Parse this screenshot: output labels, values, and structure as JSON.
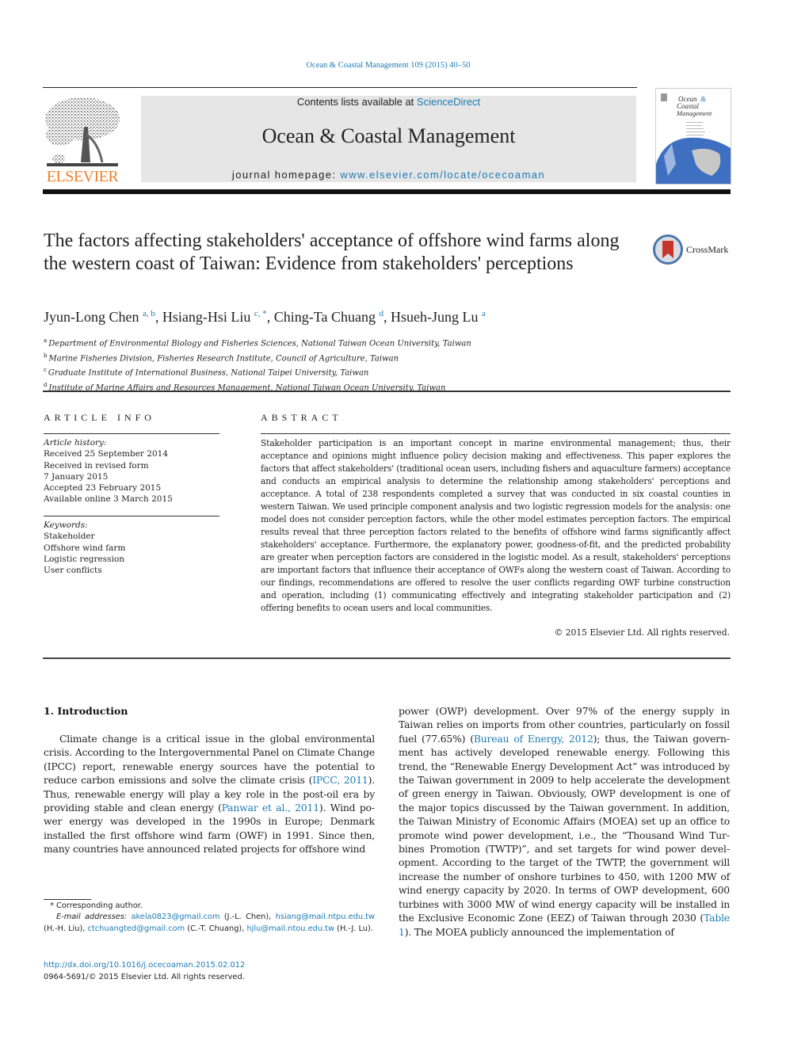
{
  "journal_reference": "Ocean & Coastal Management 109 (2015) 40–50",
  "header": {
    "publisher_logo_text": "ELSEVIER",
    "contents_prefix": "Contents lists available at ",
    "contents_link": "ScienceDirect",
    "journal_title": "Ocean & Coastal Management",
    "homepage_prefix": "journal homepage: ",
    "homepage_link": "www.elsevier.com/locate/ocecoaman",
    "cover_title_lines": [
      "Ocean &",
      "Coastal",
      "Management"
    ],
    "colors": {
      "link": "#1c7bb5",
      "elsevier_orange": "#f07e26",
      "banner_bg": "#e6e6e6"
    }
  },
  "article": {
    "title": "The factors affecting stakeholders' acceptance of offshore wind farms along the western coast of Taiwan: Evidence from stakeholders' perceptions",
    "crossmark_label": "CrossMark",
    "authors": [
      {
        "name": "Jyun-Long Chen",
        "sup": "a, b",
        "sep": ", "
      },
      {
        "name": "Hsiang-Hsi Liu",
        "sup": "c, *",
        "sep": ", "
      },
      {
        "name": "Ching-Ta Chuang",
        "sup": "d",
        "sep": ", "
      },
      {
        "name": "Hsueh-Jung Lu",
        "sup": "a",
        "sep": ""
      }
    ],
    "affiliations": [
      {
        "key": "a",
        "text": "Department of Environmental Biology and Fisheries Sciences, National Taiwan Ocean University, Taiwan"
      },
      {
        "key": "b",
        "text": "Marine Fisheries Division, Fisheries Research Institute, Council of Agriculture, Taiwan"
      },
      {
        "key": "c",
        "text": "Graduate Institute of International Business, National Taipei University, Taiwan"
      },
      {
        "key": "d",
        "text": "Institute of Marine Affairs and Resources Management, National Taiwan Ocean University, Taiwan"
      }
    ]
  },
  "article_info": {
    "heading": "ARTICLE INFO",
    "history_label": "Article history:",
    "history": [
      "Received 25 September 2014",
      "Received in revised form",
      "7 January 2015",
      "Accepted 23 February 2015",
      "Available online 3 March 2015"
    ],
    "keywords_label": "Keywords:",
    "keywords": [
      "Stakeholder",
      "Offshore wind farm",
      "Logistic regression",
      "User conflicts"
    ]
  },
  "abstract": {
    "heading": "ABSTRACT",
    "text": "Stakeholder participation is an important concept in marine environmental management; thus, their acceptance and opinions might influence policy decision making and effectiveness. This paper explores the factors that affect stakeholders' (traditional ocean users, including fishers and aquaculture farmers) acceptance and conducts an empirical analysis to determine the relationship among stakeholders' per­ceptions and acceptance. A total of 238 respondents completed a survey that was conducted in six coastal counties in western Taiwan. We used principle component analysis and two logistic regression models for the analysis: one model does not consider perception factors, while the other model estimates perception factors. The empirical results reveal that three perception factors related to the benefits of offshore wind farms significantly affect stakeholders' acceptance. Furthermore, the explanatory power, goodness-of-fit, and the predicted probability are greater when perception factors are considered in the logistic model. As a result, stakeholders' perceptions are important factors that influence their accep­tance of OWFs along the western coast of Taiwan. According to our findings, recommendations are offered to resolve the user conflicts regarding OWF turbine construction and operation, including (1) communicating effectively and integrating stakeholder participation and (2) offering benefits to ocean users and local communities.",
    "copyright": "© 2015 Elsevier Ltd. All rights reserved."
  },
  "introduction": {
    "heading": "1.  Introduction",
    "left_segments": [
      {
        "t": "Climate change is a critical issue in the global environmental crisis. According to the Intergovernmental Panel on Climate Change (IPCC) report, renewable energy sources have the potential to reduce carbon emissions and solve the climate crisis ("
      },
      {
        "t": "IPCC, 2011",
        "link": true
      },
      {
        "t": "). Thus, renewable energy will play a key role in the post-oil era by providing stable and clean energy ("
      },
      {
        "t": "Panwar et al., 2011",
        "link": true
      },
      {
        "t": "). Wind po­wer energy was developed in the 1990s in Europe; Denmark installed the first offshore wind farm (OWF) in 1991. Since then, many countries have announced related projects for offshore wind"
      }
    ],
    "right_segments": [
      {
        "t": "power (OWP) development. Over 97% of the energy supply in Taiwan relies on imports from other countries, particularly on fossil fuel (77.65%) ("
      },
      {
        "t": "Bureau of Energy, 2012",
        "link": true
      },
      {
        "t": "); thus, the Taiwan govern­ment has actively developed renewable energy. Following this trend, the “Renewable Energy Development Act” was introduced by the Taiwan government in 2009 to help accelerate the development of green energy in Taiwan. Obviously, OWP development is one of the major topics discussed by the Taiwan government. In addition, the Taiwan Ministry of Economic Affairs (MOEA) set up an office to promote wind power development, i.e., the “Thousand Wind Tur­bines Promotion (TWTP)”, and set targets for wind power devel­opment. According to the target of the TWTP, the government will increase the number of onshore turbines to 450, with 1200 MW of wind energy capacity by 2020. In terms of OWP development, 600 turbines with 3000 MW of wind energy capacity will be installed in the Exclusive Economic Zone (EEZ) of Taiwan through 2030 ("
      },
      {
        "t": "Table 1",
        "link": true
      },
      {
        "t": "). The MOEA publicly announced the implementation of"
      }
    ]
  },
  "footnote": {
    "corresponding": "* Corresponding author.",
    "email_label": "E-mail addresses:",
    "emails": [
      {
        "email": "akela0823@gmail.com",
        "who": " (J.-L. Chen), "
      },
      {
        "email": "hsiang@mail.ntpu.edu.tw",
        "who": " (H.-H. Liu), "
      },
      {
        "email": "ctchuangted@gmail.com",
        "who": " (C.-T. Chuang), "
      },
      {
        "email": "hjlu@mail.ntou.edu.tw",
        "who": " (H.-J. Lu)."
      }
    ],
    "doi": "http://dx.doi.org/10.1016/j.ocecoaman.2015.02.012",
    "issn_line": "0964-5691/© 2015 Elsevier Ltd. All rights reserved."
  }
}
